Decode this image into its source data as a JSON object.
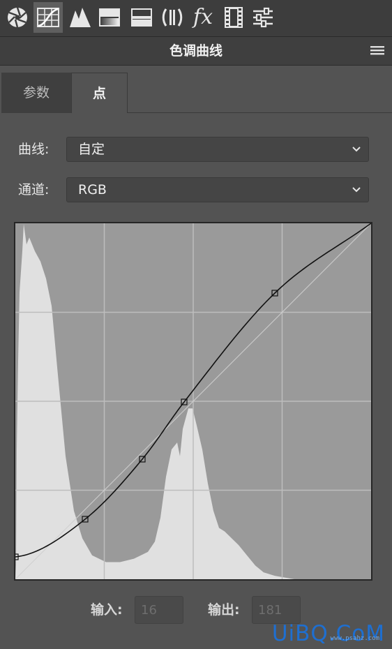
{
  "toolbar": {
    "tools": [
      {
        "name": "brightness-icon"
      },
      {
        "name": "curves-icon",
        "active": true
      },
      {
        "name": "levels-icon"
      },
      {
        "name": "gradient-map-icon"
      },
      {
        "name": "threshold-icon"
      },
      {
        "name": "vibrance-icon"
      },
      {
        "name": "fx-icon",
        "label": "fx"
      },
      {
        "name": "film-icon"
      },
      {
        "name": "sliders-icon"
      }
    ]
  },
  "panel": {
    "title": "色调曲线",
    "menu_icon": "hamburger-menu-icon"
  },
  "tabs": [
    {
      "label": "参数",
      "active": false
    },
    {
      "label": "点",
      "active": true
    }
  ],
  "curve_row": {
    "label": "曲线:",
    "value": "自定"
  },
  "channel_row": {
    "label": "通道:",
    "value": "RGB"
  },
  "curve": {
    "range": [
      0,
      255
    ],
    "gridlines": 4,
    "points": [
      [
        0,
        16
      ],
      [
        50,
        43
      ],
      [
        91,
        86
      ],
      [
        121,
        127
      ],
      [
        186,
        205
      ],
      [
        255,
        255
      ]
    ],
    "colors": {
      "background": "#9a9a9a",
      "histogram": "#e0e0e0",
      "grid": "#bdbdbd",
      "curve": "#111111",
      "baseline": "#cfcfcf"
    }
  },
  "io": {
    "input_label": "输入:",
    "input_value": "16",
    "output_label": "输出:",
    "output_value": "181"
  },
  "watermark": {
    "text": "UiBQ.CoM",
    "small": "www.psahz.com"
  }
}
